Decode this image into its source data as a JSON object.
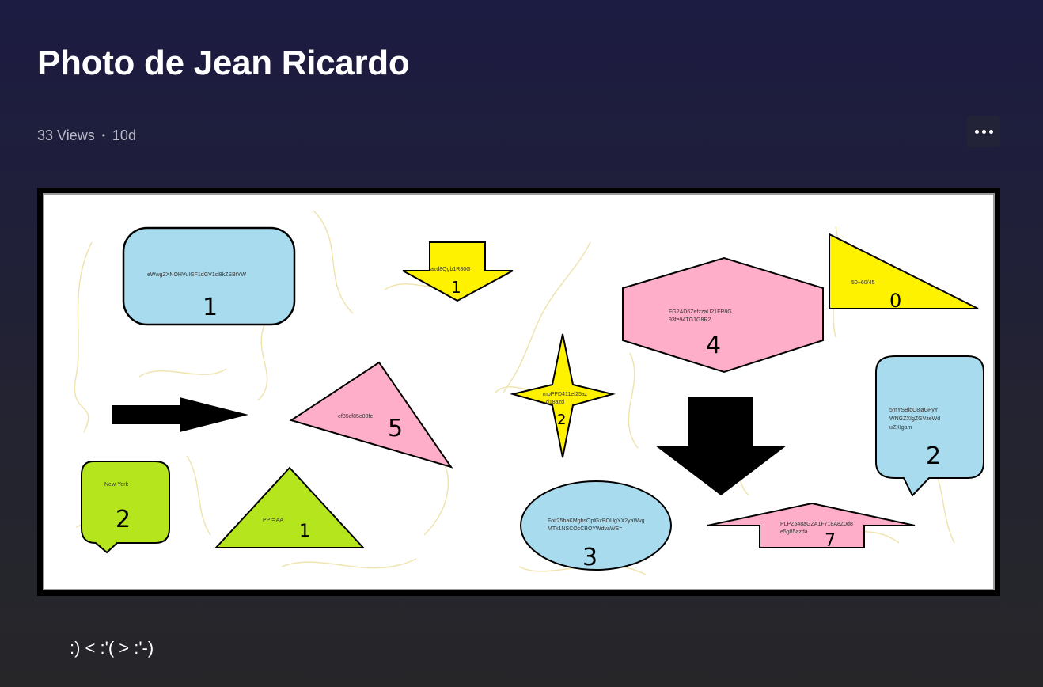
{
  "post": {
    "title": "Photo de Jean Ricardo",
    "views": "33 Views",
    "age": "10d",
    "caption": ":) < :'( > :'-)"
  },
  "photo": {
    "shapes": {
      "rounded_rect_label": "eWwgZXNOHVuIGF1dGV1cl8kZSBtYW",
      "rounded_rect_num": "1",
      "down_arrow_label": "azd8Qgb1R80G",
      "down_arrow_num": "1",
      "triangle_right_label": "50+60/45",
      "triangle_right_num": "0",
      "hexagon_label_1": "FG2AD6ZefzzaU21FR8G",
      "hexagon_label_2": "93fe94TG1G8R2",
      "hexagon_num": "4",
      "star_label_1": "mpPPD411ef25az",
      "star_label_2": "d18azd",
      "star_num": "2",
      "pink_triangle_label": "ef85cf85e80fe",
      "pink_triangle_num": "5",
      "speech_blue_label_1": "5mYSBldC8jaGFyY",
      "speech_blue_label_2": "WNGZXIgZGVzeWd",
      "speech_blue_label_3": "uZXIgam",
      "speech_blue_num": "2",
      "speech_green_label": "New-York",
      "speech_green_num": "2",
      "green_triangle_label": "PP = AA",
      "green_triangle_num": "1",
      "ellipse_label_1": "Foit25haKMgbsOplGxBOUgYX2yaWvg",
      "ellipse_label_2": "MTk1NSCOcCBOYWdvaWE=",
      "ellipse_num": "3",
      "up_arrow_label_1": "PLPZ548aGZA1F718A8Z0d8",
      "up_arrow_label_2": "e5g85azda",
      "up_arrow_num": "7"
    },
    "colors": {
      "blue": "#a8dbed",
      "yellow": "#fff200",
      "pink": "#ffaec9",
      "green": "#b5e61d",
      "squiggle": "#efe4b0"
    }
  },
  "icons": {
    "more": "ellipsis-horizontal"
  }
}
